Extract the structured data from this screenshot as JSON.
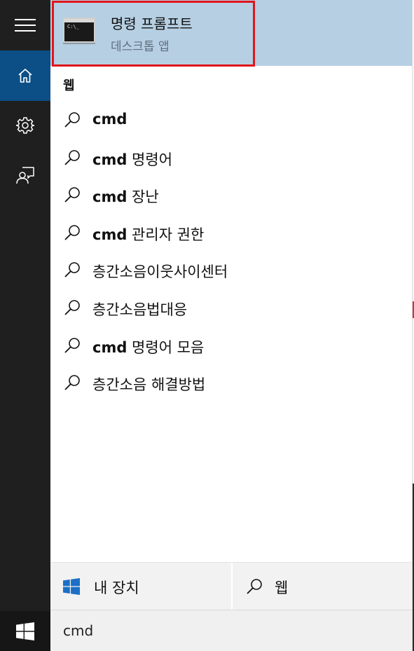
{
  "rail": {
    "items": [
      {
        "name": "hamburger-menu",
        "icon": "hamburger-icon"
      },
      {
        "name": "home",
        "icon": "home-icon",
        "active": true
      },
      {
        "name": "settings",
        "icon": "gear-icon"
      },
      {
        "name": "feedback",
        "icon": "feedback-icon"
      }
    ],
    "start_icon": "windows-logo-icon",
    "active_color": "#0b4f86"
  },
  "best_match": {
    "title": "명령 프롬프트",
    "subtitle": "데스크톱 앱",
    "icon_text": "C:\\_",
    "highlight_color": "#b6cfe3",
    "frame_color": "#e1151c"
  },
  "web_section": {
    "label": "웹",
    "suggestions": [
      {
        "bold": "cmd",
        "rest": ""
      },
      {
        "bold": "cmd",
        "rest": " 명령어"
      },
      {
        "bold": "cmd",
        "rest": " 장난"
      },
      {
        "bold": "cmd",
        "rest": " 관리자 권한"
      },
      {
        "bold": "",
        "rest": "층간소음이웃사이센터"
      },
      {
        "bold": "",
        "rest": "층간소음법대응"
      },
      {
        "bold": "cmd",
        "rest": " 명령어 모음"
      },
      {
        "bold": "",
        "rest": "층간소음 해결방법"
      }
    ]
  },
  "filters": {
    "my_stuff": "내 장치",
    "web": "웹"
  },
  "search": {
    "value": "cmd"
  }
}
